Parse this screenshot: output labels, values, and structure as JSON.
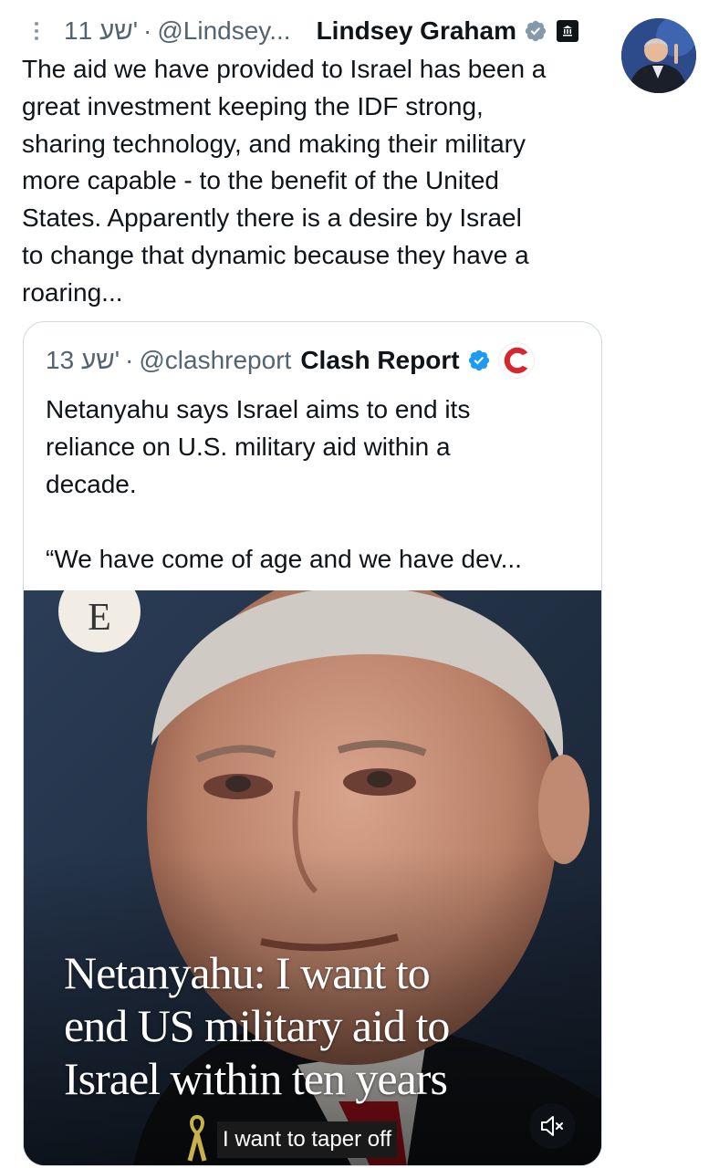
{
  "tweet": {
    "time": "11 שע'",
    "handle": "@Lindsey...",
    "display_name": "Lindsey Graham",
    "text": "The aid we have provided to Israel has been a\ngreat investment keeping the IDF strong,\nsharing technology, and making their military\nmore capable - to the benefit of the United\nStates. Apparently there is a desire by Israel\nto change that dynamic because they have a\nroaring..."
  },
  "quote": {
    "time": "13 שע'",
    "handle": "@clashreport",
    "display_name": "Clash Report",
    "text": "Netanyahu says Israel aims to end its\nreliance on U.S. military aid within a\ndecade.\n\n“We have come of age and we have dev...",
    "media": {
      "logo_letter": "E",
      "headline": "Netanyahu: I want to\nend US military aid to\nIsrael within ten years",
      "caption": "I want to taper off"
    }
  },
  "colors": {
    "verified_blue": "#1d9bf0",
    "verified_gray": "#829aab",
    "secondary_text": "#536471",
    "border": "#cfd9de"
  },
  "icons": [
    "more-vertical-icon",
    "verified-badge-icon",
    "government-badge-icon",
    "clash-report-logo",
    "mute-icon"
  ]
}
